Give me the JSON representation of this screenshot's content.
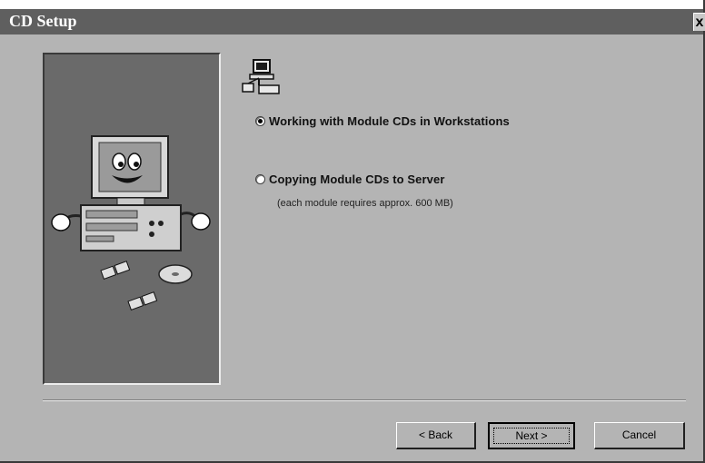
{
  "window": {
    "title": "CD Setup",
    "close_label": "x"
  },
  "options": [
    {
      "label": "Working with Module CDs in Workstations",
      "selected": true
    },
    {
      "label": "Copying Module CDs to Server",
      "selected": false,
      "note": "(each module requires approx. 600 MB)"
    }
  ],
  "buttons": {
    "back": "< Back",
    "next": "Next >",
    "cancel": "Cancel"
  },
  "icons": {
    "header": "computer-network-icon",
    "illustration": "cartoon-computer-illustration"
  }
}
